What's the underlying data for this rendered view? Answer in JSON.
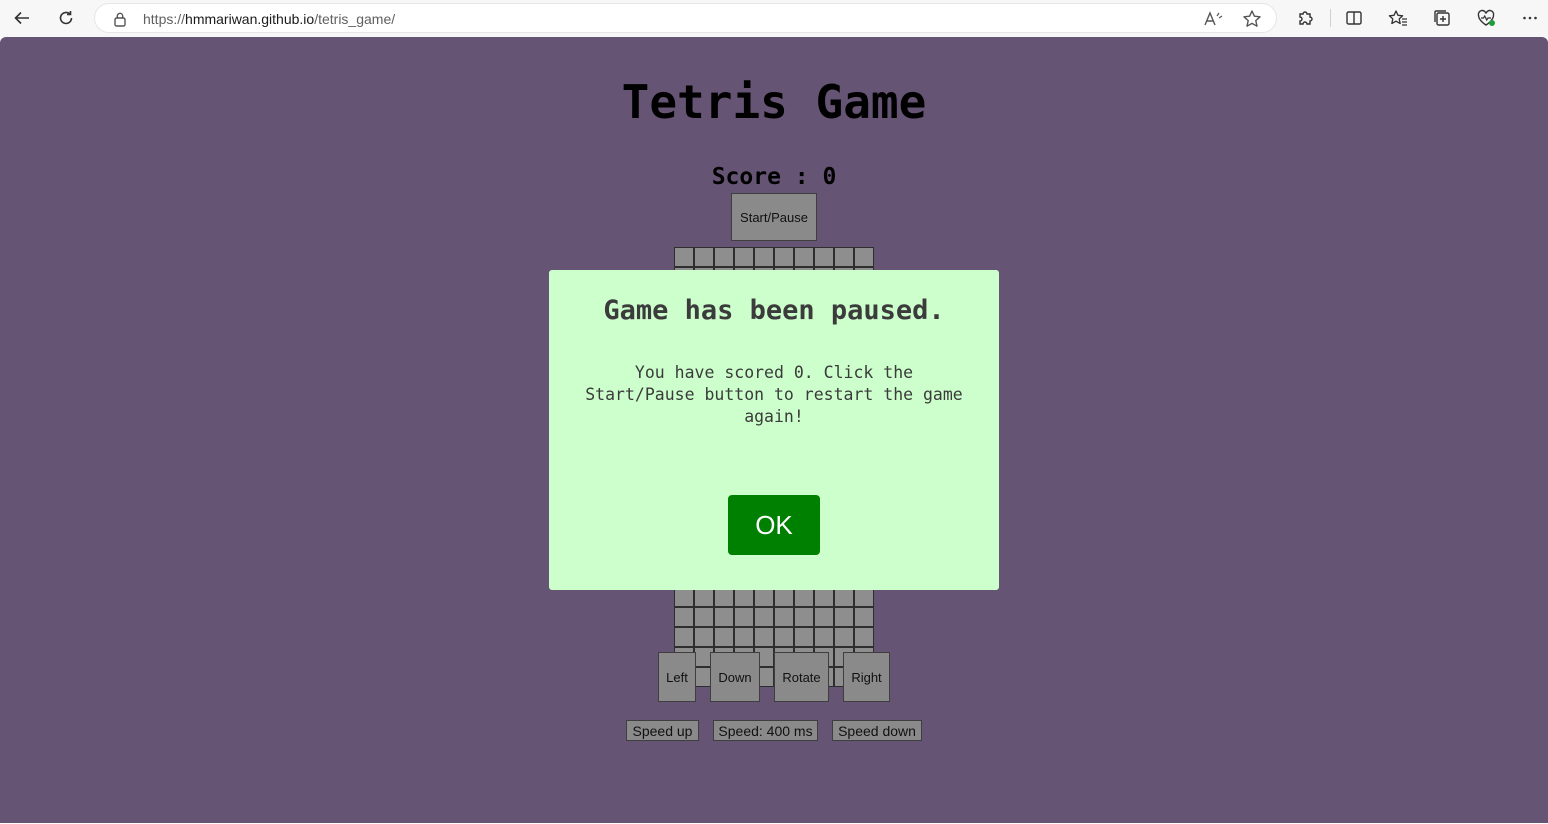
{
  "browser": {
    "url_prefix": "https://",
    "url_host": "hmmariwan.github.io",
    "url_path": "/tetris_game/"
  },
  "game": {
    "title": "Tetris Game",
    "score_text": "Score : 0",
    "start_pause_label": "Start/Pause",
    "controls": {
      "left": "Left",
      "down": "Down",
      "rotate": "Rotate",
      "right": "Right"
    },
    "speed": {
      "up": "Speed up",
      "current": "Speed: 400 ms",
      "down": "Speed down"
    }
  },
  "modal": {
    "title": "Game has been paused.",
    "message": "You have scored 0. Click the Start/Pause button to restart the game again!",
    "ok_label": "OK"
  },
  "colors": {
    "page_bg": "#655473",
    "modal_bg": "#ccffcc",
    "ok_button": "#008000",
    "cell": "#8e8e8e"
  },
  "icons": [
    "back-arrow-icon",
    "refresh-icon",
    "lock-icon",
    "read-aloud-icon",
    "favorite-star-icon",
    "extensions-icon",
    "split-screen-icon",
    "favorites-icon",
    "collections-icon",
    "browser-essentials-icon",
    "more-icon"
  ]
}
